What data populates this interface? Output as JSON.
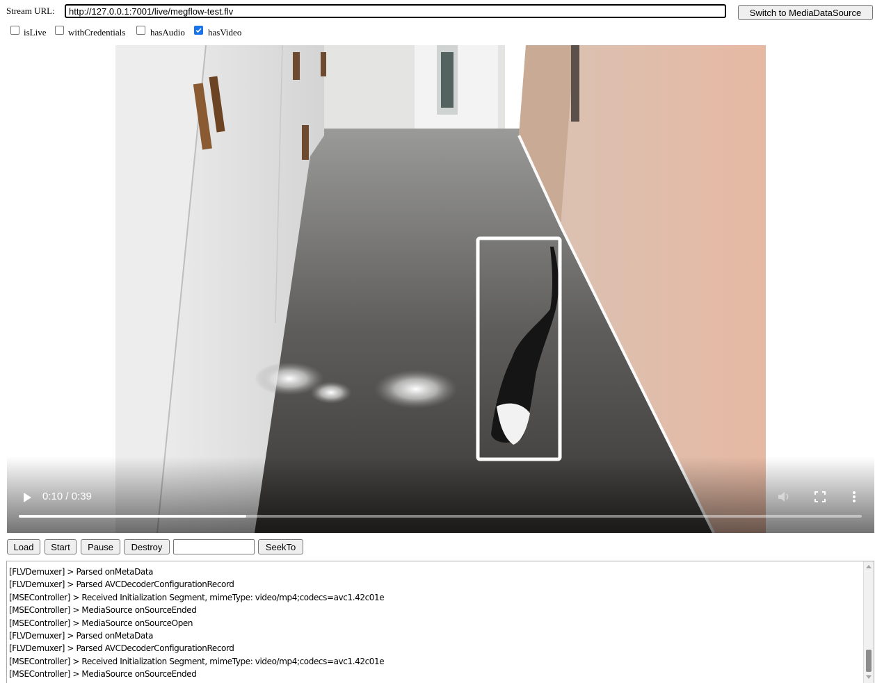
{
  "stream": {
    "label": "Stream URL:",
    "url_value": "http://127.0.0.1:7001/live/megflow-test.flv",
    "switch_label": "Switch to MediaDataSource"
  },
  "options": [
    {
      "label": "isLive",
      "checked": false
    },
    {
      "label": "withCredentials",
      "checked": false
    },
    {
      "label": "hasAudio",
      "checked": false
    },
    {
      "label": "hasVideo",
      "checked": true
    }
  ],
  "player": {
    "time_display": "0:10 / 0:39",
    "progress_fraction": 0.27,
    "icons": [
      "play-icon",
      "volume-icon",
      "fullscreen-icon",
      "more-options-icon"
    ]
  },
  "controls": {
    "load_label": "Load",
    "start_label": "Start",
    "pause_label": "Pause",
    "destroy_label": "Destroy",
    "seek_value": "",
    "seekto_label": "SeekTo"
  },
  "log": {
    "lines": [
      "[FLVDemuxer] > Parsed onMetaData",
      "[FLVDemuxer] > Parsed AVCDecoderConfigurationRecord",
      "[MSEController] > Received Initialization Segment, mimeType: video/mp4;codecs=avc1.42c01e",
      "[MSEController] > MediaSource onSourceEnded",
      "[MSEController] > MediaSource onSourceOpen",
      "[FLVDemuxer] > Parsed onMetaData",
      "[FLVDemuxer] > Parsed AVCDecoderConfigurationRecord",
      "[MSEController] > Received Initialization Segment, mimeType: video/mp4;codecs=avc1.42c01e",
      "[MSEController] > MediaSource onSourceEnded"
    ]
  }
}
